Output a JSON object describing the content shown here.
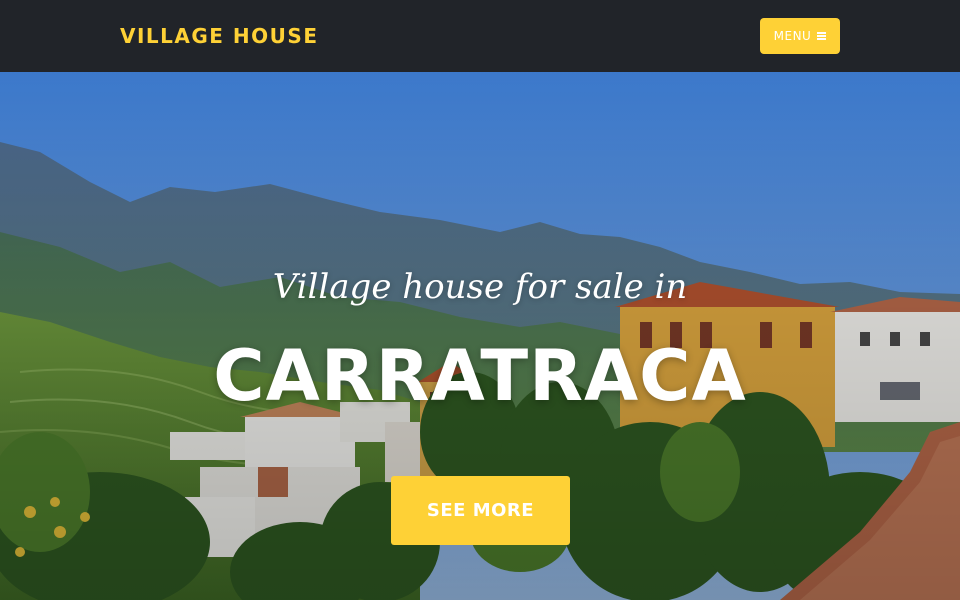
{
  "navbar": {
    "brand": "VILLAGE HOUSE",
    "menu_label": "MENU",
    "menu_icon": "bars-icon"
  },
  "hero": {
    "subheading": "Village house for sale in",
    "heading": "CARRATRACA",
    "cta_label": "SEE MORE",
    "background_image": "mountain-village-photo"
  },
  "colors": {
    "navbar_bg": "#212429",
    "accent": "#fed136",
    "text_light": "#ffffff"
  }
}
